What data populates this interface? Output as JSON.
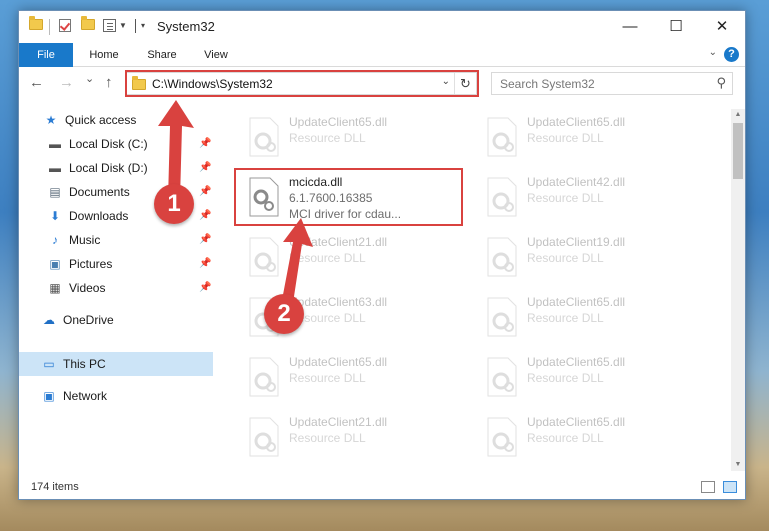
{
  "window": {
    "title": "System32",
    "minimize_glyph": "—",
    "maximize_glyph": "☐",
    "close_glyph": "✕"
  },
  "ribbon": {
    "tabs": [
      {
        "label": "File"
      },
      {
        "label": "Home"
      },
      {
        "label": "Share"
      },
      {
        "label": "View"
      }
    ],
    "help_glyph": "?",
    "collapse_glyph": "⌄"
  },
  "nav": {
    "back_glyph": "←",
    "forward_glyph": "→",
    "recent_glyph": "⌄",
    "up_glyph": "↑",
    "address": "C:\\Windows\\System32",
    "address_dropdown_glyph": "⌄",
    "refresh_glyph": "↻",
    "search_placeholder": "Search System32",
    "search_glyph": "⚲"
  },
  "sidebar": {
    "items": [
      {
        "label": "Quick access",
        "icon": "star-icon",
        "glyph": "★",
        "color": "#2b7cd3"
      },
      {
        "label": "Local Disk (C:)",
        "icon": "drive-icon",
        "glyph": "▬",
        "color": "#555555",
        "pinned": true
      },
      {
        "label": "Local Disk (D:)",
        "icon": "drive-icon",
        "glyph": "▬",
        "color": "#555555",
        "pinned": true
      },
      {
        "label": "Documents",
        "icon": "documents-icon",
        "glyph": "▤",
        "color": "#5a6a7a",
        "pinned": true
      },
      {
        "label": "Downloads",
        "icon": "download-icon",
        "glyph": "⬇",
        "color": "#2b7cd3",
        "pinned": true
      },
      {
        "label": "Music",
        "icon": "music-icon",
        "glyph": "♪",
        "color": "#2b7cd3",
        "pinned": true
      },
      {
        "label": "Pictures",
        "icon": "pictures-icon",
        "glyph": "▣",
        "color": "#4a7fb0",
        "pinned": true
      },
      {
        "label": "Videos",
        "icon": "videos-icon",
        "glyph": "▦",
        "color": "#555555",
        "pinned": true
      },
      {
        "label": "OneDrive",
        "icon": "cloud-icon",
        "glyph": "☁",
        "color": "#1f6fc5"
      },
      {
        "label": "This PC",
        "icon": "computer-icon",
        "glyph": "▭",
        "color": "#2b7cd3",
        "selected": true
      },
      {
        "label": "Network",
        "icon": "network-icon",
        "glyph": "▣",
        "color": "#2b7cd3"
      }
    ],
    "pin_glyph": "📌"
  },
  "files": [
    {
      "name": "UpdateClient65.dll",
      "desc": "Resource DLL",
      "faded": true
    },
    {
      "name": "UpdateClient65.dll",
      "desc": "Resource DLL",
      "faded": true
    },
    {
      "name": "mcicda.dll",
      "desc": "6.1.7600.16385",
      "desc2": "MCI driver for cdau...",
      "faded": false
    },
    {
      "name": "UpdateClient42.dll",
      "desc": "Resource DLL",
      "faded": true
    },
    {
      "name": "UpdateClient21.dll",
      "desc": "Resource DLL",
      "faded": true
    },
    {
      "name": "UpdateClient19.dll",
      "desc": "Resource DLL",
      "faded": true
    },
    {
      "name": "UpdateClient63.dll",
      "desc": "Resource DLL",
      "faded": true
    },
    {
      "name": "UpdateClient65.dll",
      "desc": "Resource DLL",
      "faded": true
    },
    {
      "name": "UpdateClient65.dll",
      "desc": "Resource DLL",
      "faded": true
    },
    {
      "name": "UpdateClient65.dll",
      "desc": "Resource DLL",
      "faded": true
    },
    {
      "name": "UpdateClient21.dll",
      "desc": "Resource DLL",
      "faded": true
    },
    {
      "name": "UpdateClient65.dll",
      "desc": "Resource DLL",
      "faded": true
    }
  ],
  "status": {
    "item_count": "174 items"
  },
  "annotations": {
    "step1": "1",
    "step2": "2",
    "accent": "#d9423f"
  }
}
